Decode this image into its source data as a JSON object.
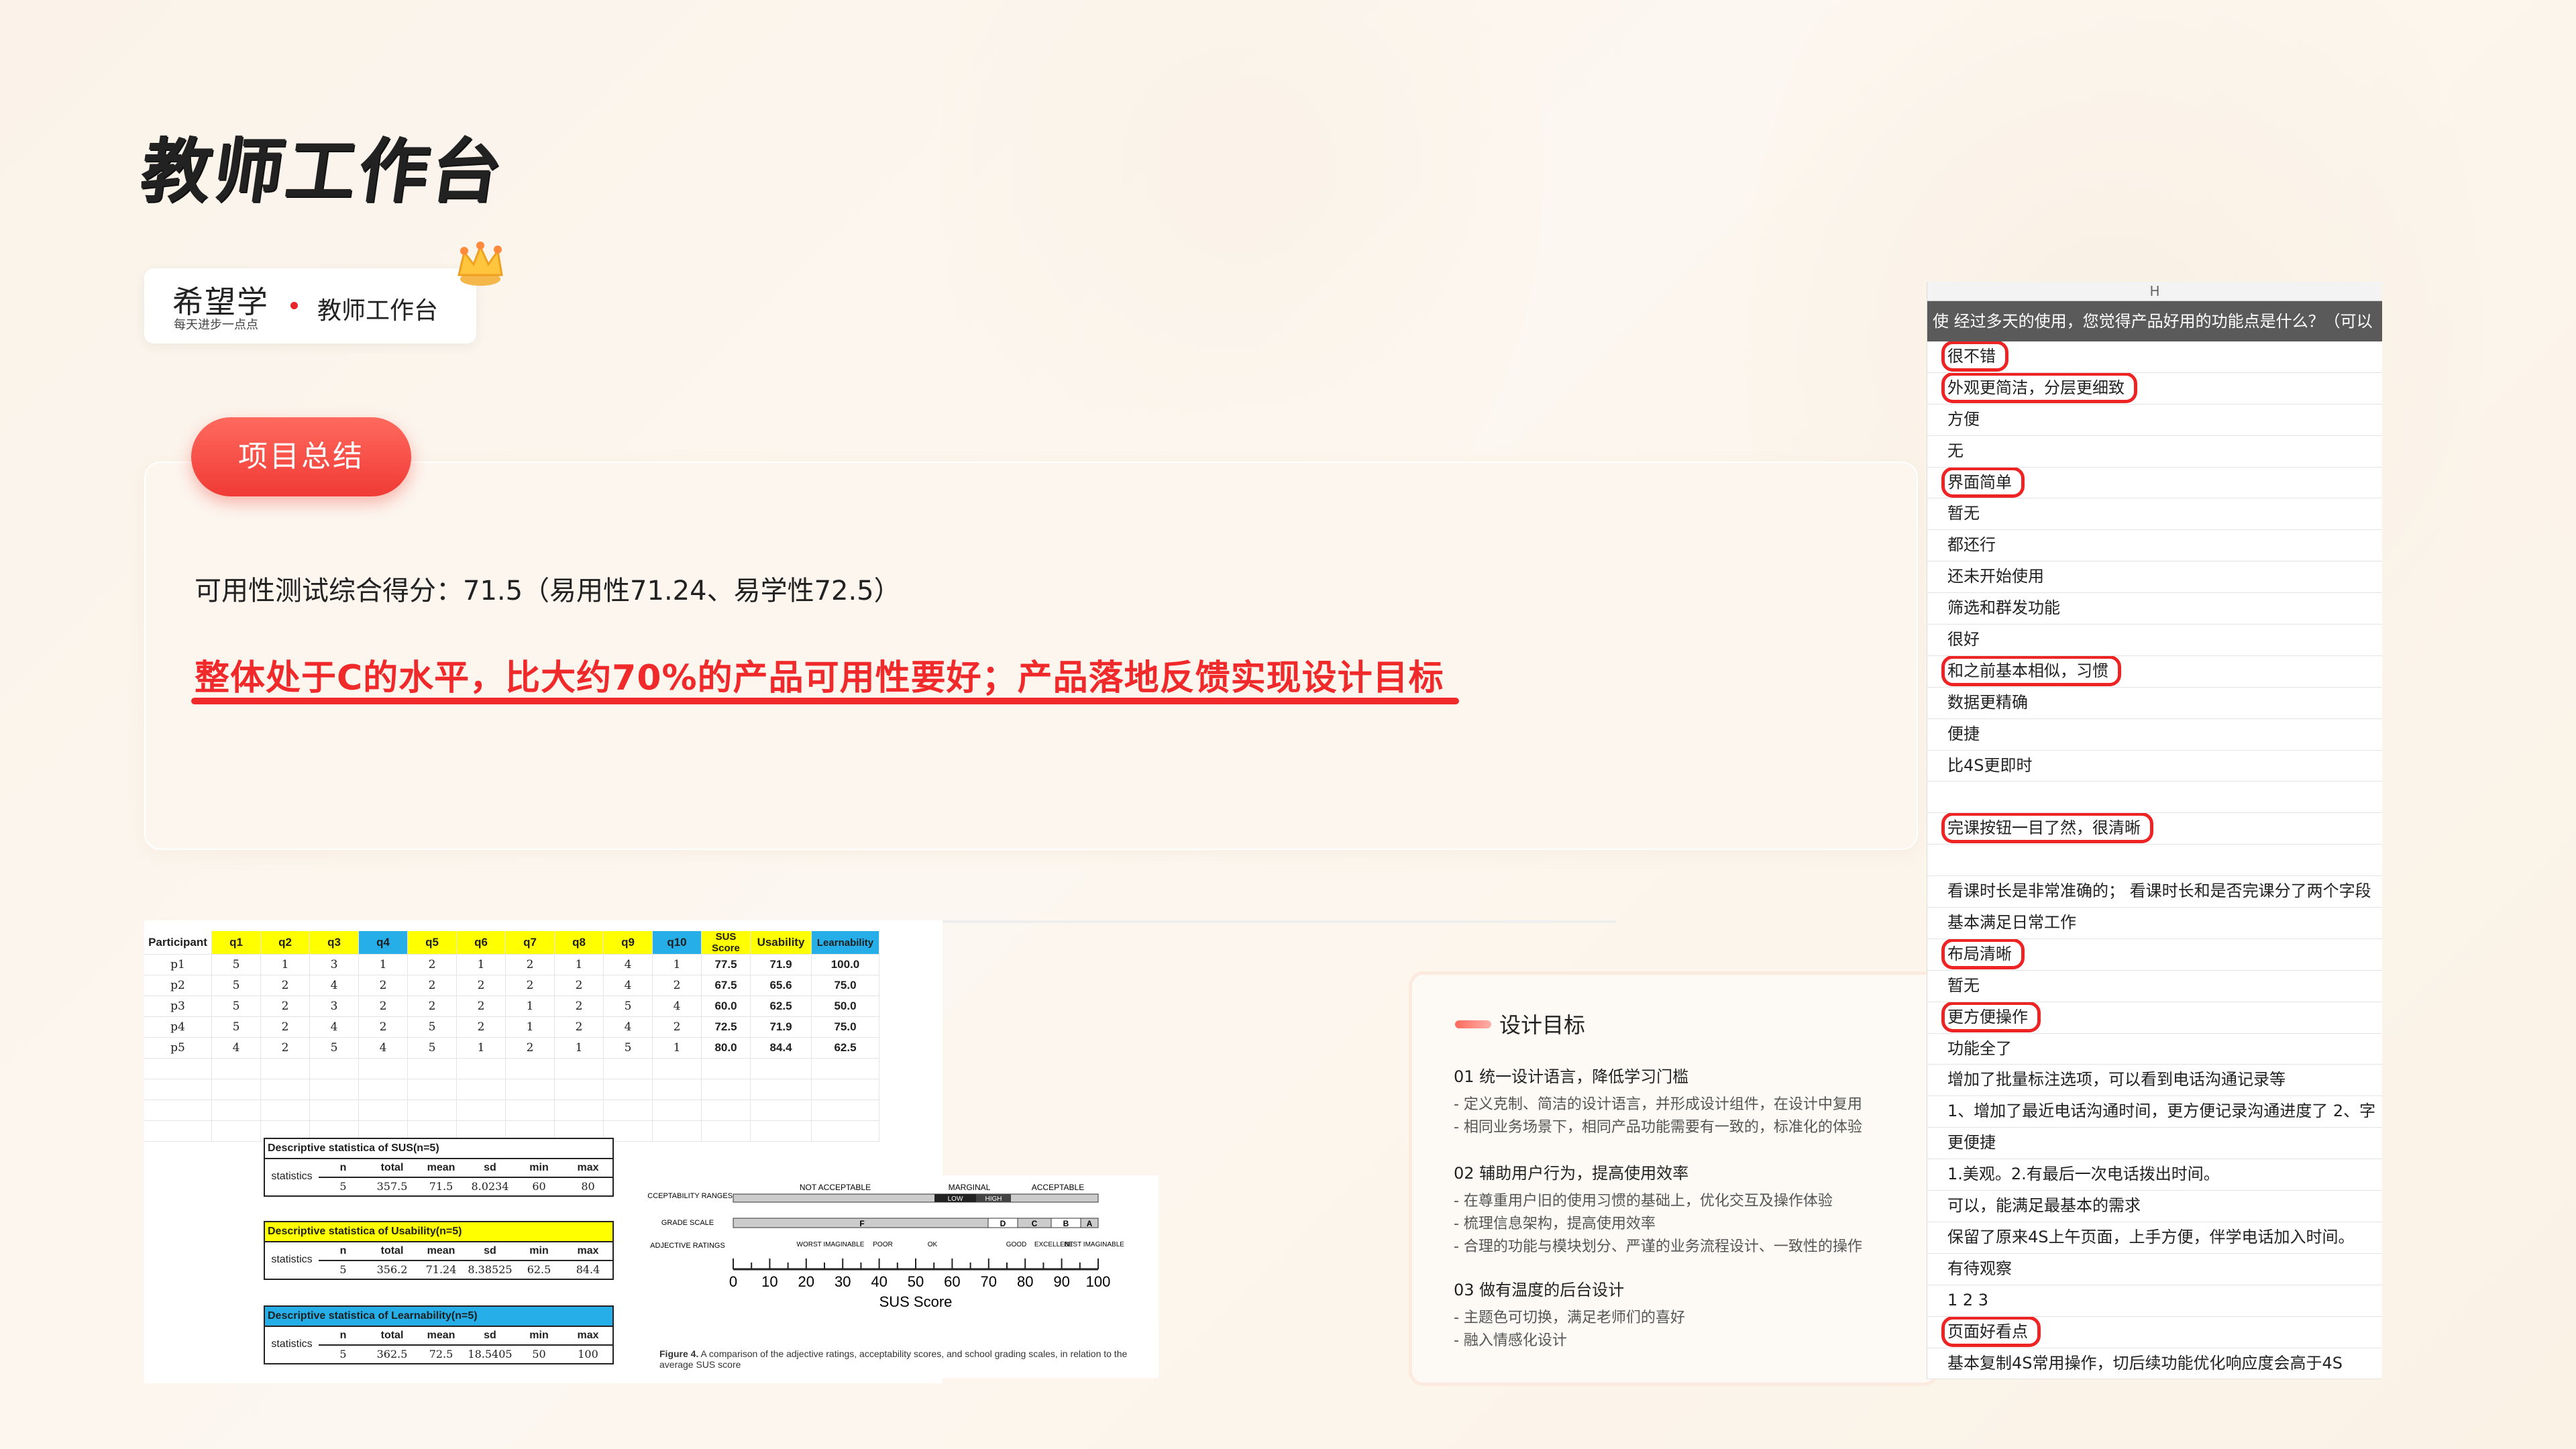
{
  "page": {
    "title": "教师工作台"
  },
  "brand": {
    "name": "希望学",
    "slogan": "每天进步一点点",
    "page_name": "教师工作台"
  },
  "summary": {
    "section_label": "项目总结",
    "score_text": "可用性测试综合得分：71.5（易用性71.24、易学性72.5）",
    "highlight_text": "整体处于C的水平，比大约70%的产品可用性要好；产品落地反馈实现设计目标",
    "accent_color": "#f02a2a"
  },
  "sus_table": {
    "headers": [
      "Participant",
      "q1",
      "q2",
      "q3",
      "q4",
      "q5",
      "q6",
      "q7",
      "q8",
      "q9",
      "q10",
      "SUS Score",
      "Usability",
      "Learnability"
    ],
    "rows": [
      [
        "p1",
        "5",
        "1",
        "3",
        "1",
        "2",
        "1",
        "2",
        "1",
        "4",
        "1",
        "77.5",
        "71.9",
        "100.0"
      ],
      [
        "p2",
        "5",
        "2",
        "4",
        "2",
        "2",
        "2",
        "2",
        "2",
        "4",
        "2",
        "67.5",
        "65.6",
        "75.0"
      ],
      [
        "p3",
        "5",
        "2",
        "3",
        "2",
        "2",
        "2",
        "1",
        "2",
        "5",
        "4",
        "60.0",
        "62.5",
        "50.0"
      ],
      [
        "p4",
        "5",
        "2",
        "4",
        "2",
        "5",
        "2",
        "1",
        "2",
        "4",
        "2",
        "72.5",
        "71.9",
        "75.0"
      ],
      [
        "p5",
        "4",
        "2",
        "5",
        "4",
        "5",
        "1",
        "2",
        "1",
        "5",
        "1",
        "80.0",
        "84.4",
        "62.5"
      ]
    ],
    "stat_columns": [
      "n",
      "total",
      "mean",
      "sd",
      "min",
      "max"
    ],
    "stat_row_label": "statistics",
    "stats": [
      {
        "title": "Descriptive statistica of SUS(n=5)",
        "values": [
          "5",
          "357.5",
          "71.5",
          "8.0234",
          "60",
          "80"
        ]
      },
      {
        "title": "Descriptive statistica of Usability(n=5)",
        "values": [
          "5",
          "356.2",
          "71.24",
          "8.38525",
          "62.5",
          "84.4"
        ]
      },
      {
        "title": "Descriptive statistica of Learnability(n=5)",
        "values": [
          "5",
          "362.5",
          "72.5",
          "18.5405",
          "50",
          "100"
        ]
      }
    ]
  },
  "sus_figure": {
    "range_labels": [
      "ACCEPTABILITY RANGES",
      "GRADE SCALE",
      "ADJECTIVE RATINGS"
    ],
    "acceptability": [
      "NOT ACCEPTABLE",
      "MARGINAL",
      "ACCEPTABLE",
      "LOW",
      "HIGH"
    ],
    "grades": [
      "F",
      "D",
      "C",
      "B",
      "A"
    ],
    "adjectives": [
      "WORST IMAGINABLE",
      "POOR",
      "OK",
      "GOOD",
      "EXCELLENT",
      "BEST IMAGINABLE"
    ],
    "ticks": [
      "0",
      "10",
      "20",
      "30",
      "40",
      "50",
      "60",
      "70",
      "80",
      "90",
      "100"
    ],
    "axis_title": "SUS Score",
    "caption_bold": "Figure 4.",
    "caption": " A comparison of the adjective ratings, acceptability scores, and school grading scales, in relation to the average SUS score"
  },
  "goals": {
    "title": "设计目标",
    "sections": [
      {
        "heading": "01 统一设计语言，降低学习门槛",
        "items": [
          "- 定义克制、简洁的设计语言，并形成设计组件，在设计中复用",
          "- 相同业务场景下，相同产品功能需要有一致的，标准化的体验"
        ]
      },
      {
        "heading": "02 辅助用户行为，提高使用效率",
        "items": [
          "- 在尊重用户旧的使用习惯的基础上，优化交互及操作体验",
          "- 梳理信息架构，提高使用效率",
          "- 合理的功能与模块划分、严谨的业务流程设计、一致性的操作"
        ]
      },
      {
        "heading": "03 做有温度的后台设计",
        "items": [
          "- 主题色可切换，满足老师们的喜好",
          "- 融入情感化设计"
        ]
      }
    ]
  },
  "survey": {
    "column_letter": "H",
    "question": "使 经过多天的使用，您觉得产品好用的功能点是什么？（可以",
    "mark_color": "#ee2323",
    "rows": [
      {
        "text": "很不错",
        "marked": true
      },
      {
        "text": "外观更简洁，分层更细致",
        "marked": true
      },
      {
        "text": "方便",
        "marked": false
      },
      {
        "text": "无",
        "marked": false
      },
      {
        "text": "界面简单",
        "marked": true
      },
      {
        "text": "暂无",
        "marked": false
      },
      {
        "text": "都还行",
        "marked": false
      },
      {
        "text": "还未开始使用",
        "marked": false
      },
      {
        "text": "筛选和群发功能",
        "marked": false
      },
      {
        "text": "很好",
        "marked": false
      },
      {
        "text": "和之前基本相似，习惯",
        "marked": true
      },
      {
        "text": "数据更精确",
        "marked": false
      },
      {
        "text": "便捷",
        "marked": false
      },
      {
        "text": "比4S更即时",
        "marked": false
      },
      {
        "text": "",
        "marked": false
      },
      {
        "text": "完课按钮一目了然，很清晰",
        "marked": true
      },
      {
        "text": "",
        "marked": false
      },
      {
        "text": "看课时长是非常准确的；  看课时长和是否完课分了两个字段",
        "marked": false
      },
      {
        "text": "基本满足日常工作",
        "marked": false
      },
      {
        "text": "布局清晰",
        "marked": true
      },
      {
        "text": "暂无",
        "marked": false
      },
      {
        "text": "更方便操作",
        "marked": true
      },
      {
        "text": "功能全了",
        "marked": false
      },
      {
        "text": "增加了批量标注选项，可以看到电话沟通记录等",
        "marked": false
      },
      {
        "text": "1、增加了最近电话沟通时间，更方便记录沟通进度了 2、字",
        "marked": false
      },
      {
        "text": "更便捷",
        "marked": false
      },
      {
        "text": "1.美观。2.有最后一次电话拨出时间。",
        "marked": false
      },
      {
        "text": "可以，能满足最基本的需求",
        "marked": false
      },
      {
        "text": "保留了原来4S上午页面，上手方便，伴学电话加入时间。",
        "marked": false
      },
      {
        "text": "有待观察",
        "marked": false
      },
      {
        "text": "1 2 3",
        "marked": false
      },
      {
        "text": "页面好看点",
        "marked": true
      },
      {
        "text": "基本复制4S常用操作，切后续功能优化响应度会高于4S",
        "marked": false
      }
    ]
  }
}
